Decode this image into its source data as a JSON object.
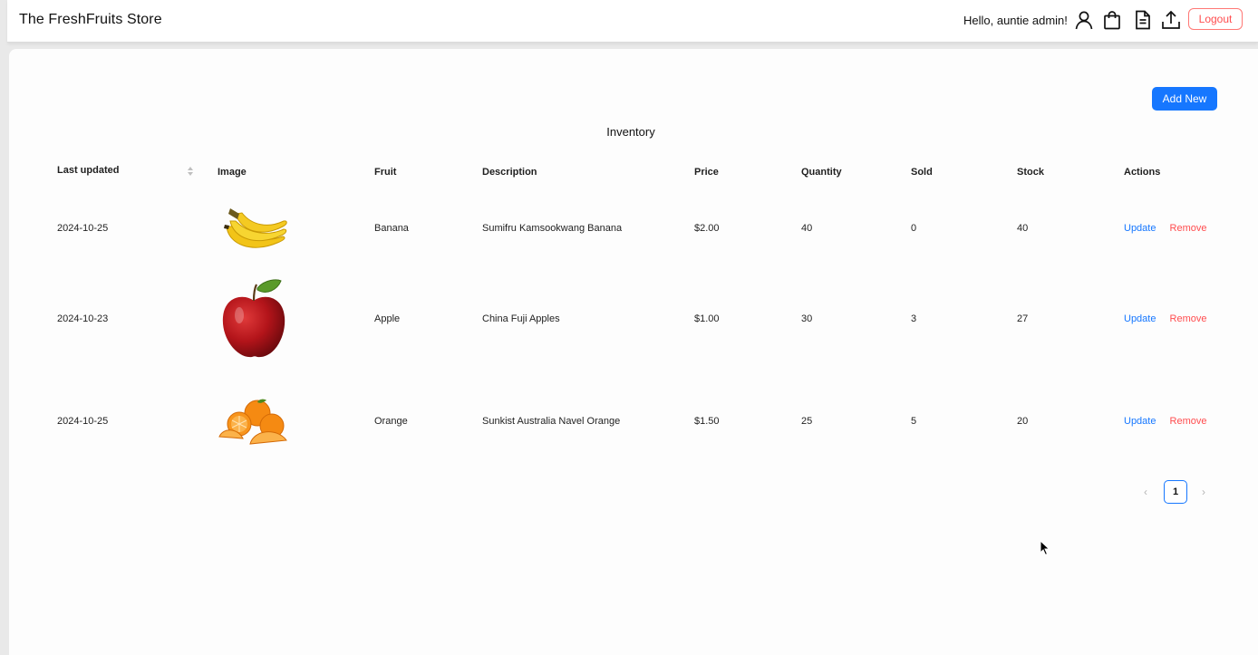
{
  "header": {
    "brand": "The FreshFruits Store",
    "greeting": "Hello, auntie admin!",
    "logout_label": "Logout"
  },
  "inventory": {
    "add_label": "Add New",
    "title": "Inventory",
    "columns": [
      "Last updated",
      "Image",
      "Fruit",
      "Description",
      "Price",
      "Quantity",
      "Sold",
      "Stock",
      "Actions"
    ],
    "rows": [
      {
        "updated": "2024-10-25",
        "image": "banana-image",
        "fruit": "Banana",
        "description": "Sumifru Kamsookwang Banana",
        "price": "$2.00",
        "quantity": "40",
        "sold": "0",
        "stock": "40"
      },
      {
        "updated": "2024-10-23",
        "image": "apple-image",
        "fruit": "Apple",
        "description": "China Fuji Apples",
        "price": "$1.00",
        "quantity": "30",
        "sold": "3",
        "stock": "27"
      },
      {
        "updated": "2024-10-25",
        "image": "orange-image",
        "fruit": "Orange",
        "description": "Sunkist Australia Navel Orange",
        "price": "$1.50",
        "quantity": "25",
        "sold": "5",
        "stock": "20"
      }
    ],
    "update_label": "Update",
    "remove_label": "Remove"
  },
  "pagination": {
    "current": "1"
  },
  "colors": {
    "primary": "#1677ff",
    "danger": "#ff4d4f"
  }
}
